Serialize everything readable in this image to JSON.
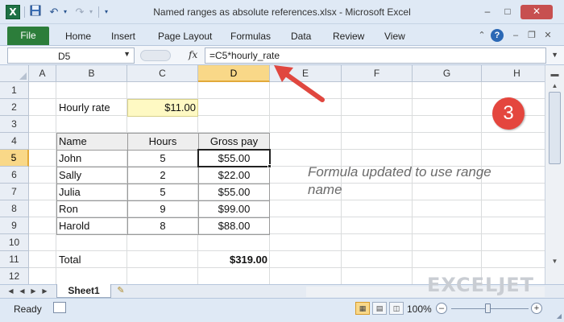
{
  "window": {
    "title": "Named ranges as absolute references.xlsx  -  Microsoft Excel",
    "app_icon": "X",
    "minimize": "–",
    "maximize": "□",
    "close": "✕"
  },
  "ribbon": {
    "file_tab": "File",
    "tabs": [
      "Home",
      "Insert",
      "Page Layout",
      "Formulas",
      "Data",
      "Review",
      "View"
    ]
  },
  "formula_bar": {
    "name_box": "D5",
    "fx": "fx",
    "formula": "=C5*hourly_rate"
  },
  "grid": {
    "columns": [
      "A",
      "B",
      "C",
      "D",
      "E",
      "F",
      "G",
      "H"
    ],
    "rows": [
      "1",
      "2",
      "3",
      "4",
      "5",
      "6",
      "7",
      "8",
      "9",
      "10",
      "11",
      "12"
    ],
    "selected_column": "D",
    "selected_row": "5"
  },
  "sheet": {
    "rate_label": "Hourly rate",
    "rate_value": "$11.00",
    "headers": [
      "Name",
      "Hours",
      "Gross pay"
    ],
    "rows": [
      {
        "name": "John",
        "hours": "5",
        "pay": "$55.00"
      },
      {
        "name": "Sally",
        "hours": "2",
        "pay": "$22.00"
      },
      {
        "name": "Julia",
        "hours": "5",
        "pay": "$55.00"
      },
      {
        "name": "Ron",
        "hours": "9",
        "pay": "$99.00"
      },
      {
        "name": "Harold",
        "hours": "8",
        "pay": "$88.00"
      }
    ],
    "total_label": "Total",
    "total_value": "$319.00"
  },
  "annotation": {
    "note": "Formula updated to use range name",
    "badge": "3"
  },
  "sheet_tabs": {
    "active": "Sheet1"
  },
  "watermark": {
    "text": "EXCELJET"
  },
  "status_bar": {
    "status": "Ready",
    "zoom": "100%"
  },
  "colors": {
    "accent_green": "#2c7d3a",
    "selection_header": "#f9d888",
    "rate_fill": "#fef9c3",
    "badge_red": "#e4463e",
    "arrow_red": "#e0473f"
  }
}
